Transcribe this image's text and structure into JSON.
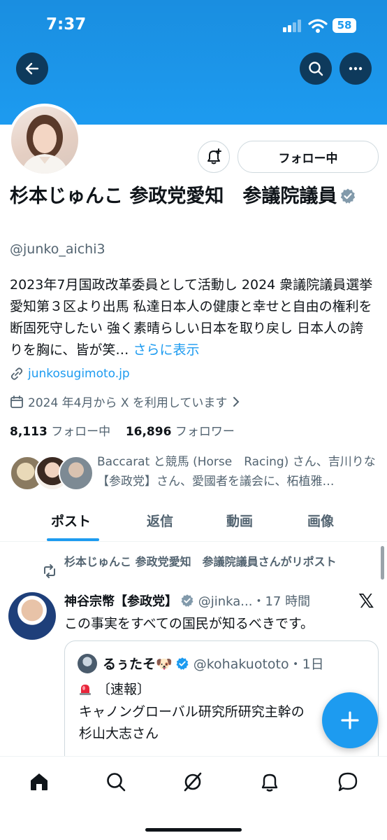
{
  "status_bar": {
    "time": "7:37",
    "battery": "58"
  },
  "profile": {
    "display_name": "杉本じゅんこ 参政党愛知　参議院議員",
    "handle": "@junko_aichi3",
    "follow_button_label": "フォロー中",
    "bio": "2023年7月国政改革委員として活動し 2024 衆議院議員選挙愛知第３区より出馬 私達日本人の健康と幸せと自由の権利を断固死守したい 強く素晴らしい日本を取り戻し 日本人の誇りを胸に、皆が笑…",
    "bio_more": "さらに表示",
    "website": "junkosugimoto.jp",
    "joined": "2024 年4月から X を利用しています",
    "following_count": "8,113",
    "following_label": "フォロー中",
    "followers_count": "16,896",
    "followers_label": "フォロワー",
    "followed_by_text": "Baccarat と競馬 (Horse　Racing) さん、吉川りな【参政党】さん、愛國者を議会に、柘植雅…"
  },
  "tabs": [
    {
      "label": "ポスト",
      "active": true
    },
    {
      "label": "返信",
      "active": false
    },
    {
      "label": "動画",
      "active": false
    },
    {
      "label": "画像",
      "active": false
    }
  ],
  "post": {
    "repost_note": "杉本じゅんこ 参政党愛知　参議院議員さんがリポスト",
    "author_name": "神谷宗幣【参政党】",
    "author_handle_meta": "@jinka...・17 時間",
    "text": "この事実をすべての国民が知るべきです。",
    "quote": {
      "author_name": "るぅたそ🐶",
      "author_handle_meta": "@kohakuototo・1日",
      "line1": "〔速報〕",
      "line2": "キャノングローバル研究所研究主幹の",
      "line3": "杉山大志さん"
    }
  },
  "icons": {
    "back": "arrow-left-icon",
    "search": "search-icon",
    "more": "more-horizontal-icon",
    "notify": "bell-plus-icon",
    "verified": "verified-badge-icon",
    "link": "link-icon",
    "calendar": "calendar-icon",
    "repost": "repost-icon",
    "compose": "plus-icon"
  },
  "colors": {
    "accent": "#1d9bf0",
    "text": "#0f1419",
    "muted": "#536471"
  }
}
